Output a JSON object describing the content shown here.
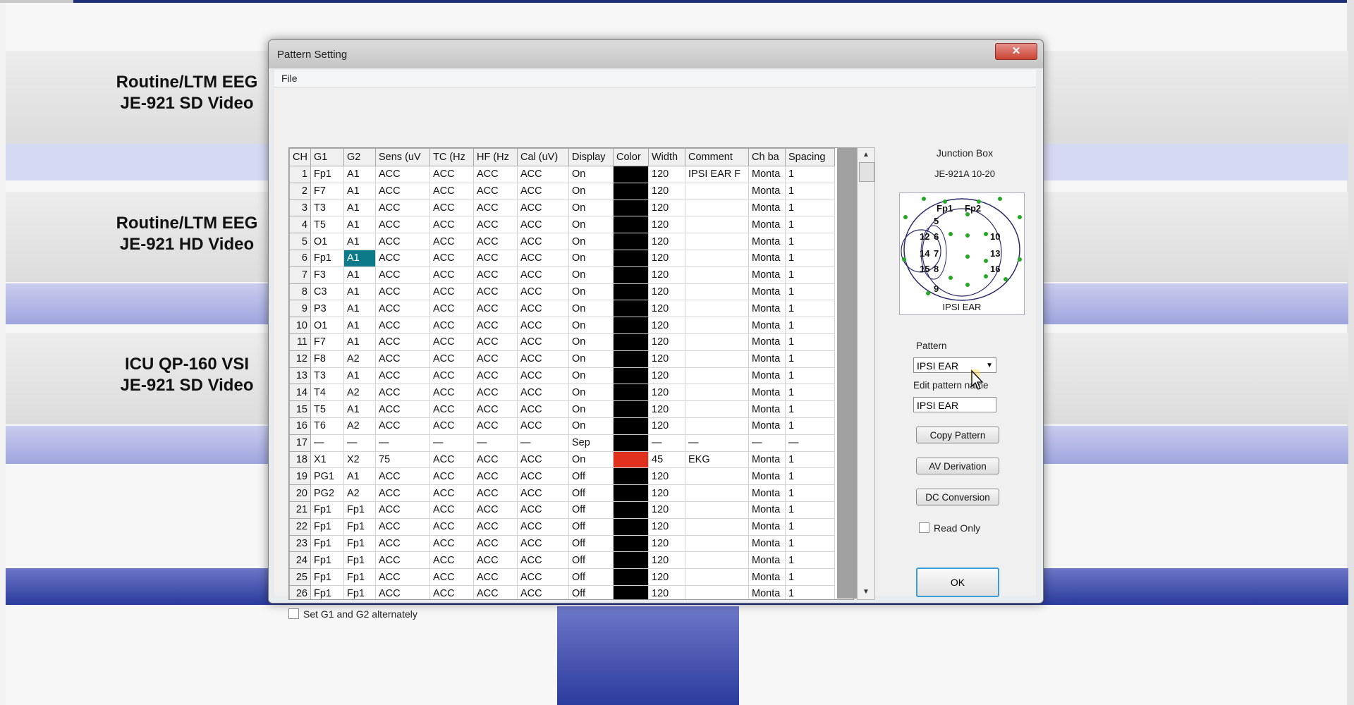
{
  "background": {
    "items": [
      {
        "line1": "Routine/LTM EEG",
        "line2": "JE-921 SD Video"
      },
      {
        "line1": "Routine/LTM EEG",
        "line2": "JE-921 HD Video"
      },
      {
        "line1": "ICU QP-160 VSI",
        "line2": "JE-921 SD Video"
      }
    ]
  },
  "dialog": {
    "title": "Pattern Setting",
    "close_label": "✕",
    "menu": {
      "file": "File"
    },
    "grid": {
      "columns": [
        "CH",
        "G1",
        "G2",
        "Sens (uV",
        "TC (Hz",
        "HF (Hz",
        "Cal (uV)",
        "Display",
        "Color",
        "Width",
        "Comment",
        "Ch ba",
        "Spacing"
      ],
      "rows": [
        {
          "ch": "1",
          "g1": "Fp1",
          "g2": "A1",
          "sens": "ACC",
          "tc": "ACC",
          "hf": "ACC",
          "cal": "ACC",
          "display": "On",
          "color": "#000000",
          "width": "120",
          "comment": "IPSI EAR F",
          "chba": "Monta",
          "spacing": "1"
        },
        {
          "ch": "2",
          "g1": "F7",
          "g2": "A1",
          "sens": "ACC",
          "tc": "ACC",
          "hf": "ACC",
          "cal": "ACC",
          "display": "On",
          "color": "#000000",
          "width": "120",
          "comment": "",
          "chba": "Monta",
          "spacing": "1"
        },
        {
          "ch": "3",
          "g1": "T3",
          "g2": "A1",
          "sens": "ACC",
          "tc": "ACC",
          "hf": "ACC",
          "cal": "ACC",
          "display": "On",
          "color": "#000000",
          "width": "120",
          "comment": "",
          "chba": "Monta",
          "spacing": "1"
        },
        {
          "ch": "4",
          "g1": "T5",
          "g2": "A1",
          "sens": "ACC",
          "tc": "ACC",
          "hf": "ACC",
          "cal": "ACC",
          "display": "On",
          "color": "#000000",
          "width": "120",
          "comment": "",
          "chba": "Monta",
          "spacing": "1"
        },
        {
          "ch": "5",
          "g1": "O1",
          "g2": "A1",
          "sens": "ACC",
          "tc": "ACC",
          "hf": "ACC",
          "cal": "ACC",
          "display": "On",
          "color": "#000000",
          "width": "120",
          "comment": "",
          "chba": "Monta",
          "spacing": "1"
        },
        {
          "ch": "6",
          "g1": "Fp1",
          "g2": "A1",
          "sens": "ACC",
          "tc": "ACC",
          "hf": "ACC",
          "cal": "ACC",
          "display": "On",
          "color": "#000000",
          "width": "120",
          "comment": "",
          "chba": "Monta",
          "spacing": "1",
          "selected": true
        },
        {
          "ch": "7",
          "g1": "F3",
          "g2": "A1",
          "sens": "ACC",
          "tc": "ACC",
          "hf": "ACC",
          "cal": "ACC",
          "display": "On",
          "color": "#000000",
          "width": "120",
          "comment": "",
          "chba": "Monta",
          "spacing": "1"
        },
        {
          "ch": "8",
          "g1": "C3",
          "g2": "A1",
          "sens": "ACC",
          "tc": "ACC",
          "hf": "ACC",
          "cal": "ACC",
          "display": "On",
          "color": "#000000",
          "width": "120",
          "comment": "",
          "chba": "Monta",
          "spacing": "1"
        },
        {
          "ch": "9",
          "g1": "P3",
          "g2": "A1",
          "sens": "ACC",
          "tc": "ACC",
          "hf": "ACC",
          "cal": "ACC",
          "display": "On",
          "color": "#000000",
          "width": "120",
          "comment": "",
          "chba": "Monta",
          "spacing": "1"
        },
        {
          "ch": "10",
          "g1": "O1",
          "g2": "A1",
          "sens": "ACC",
          "tc": "ACC",
          "hf": "ACC",
          "cal": "ACC",
          "display": "On",
          "color": "#000000",
          "width": "120",
          "comment": "",
          "chba": "Monta",
          "spacing": "1"
        },
        {
          "ch": "11",
          "g1": "F7",
          "g2": "A1",
          "sens": "ACC",
          "tc": "ACC",
          "hf": "ACC",
          "cal": "ACC",
          "display": "On",
          "color": "#000000",
          "width": "120",
          "comment": "",
          "chba": "Monta",
          "spacing": "1"
        },
        {
          "ch": "12",
          "g1": "F8",
          "g2": "A2",
          "sens": "ACC",
          "tc": "ACC",
          "hf": "ACC",
          "cal": "ACC",
          "display": "On",
          "color": "#000000",
          "width": "120",
          "comment": "",
          "chba": "Monta",
          "spacing": "1"
        },
        {
          "ch": "13",
          "g1": "T3",
          "g2": "A1",
          "sens": "ACC",
          "tc": "ACC",
          "hf": "ACC",
          "cal": "ACC",
          "display": "On",
          "color": "#000000",
          "width": "120",
          "comment": "",
          "chba": "Monta",
          "spacing": "1"
        },
        {
          "ch": "14",
          "g1": "T4",
          "g2": "A2",
          "sens": "ACC",
          "tc": "ACC",
          "hf": "ACC",
          "cal": "ACC",
          "display": "On",
          "color": "#000000",
          "width": "120",
          "comment": "",
          "chba": "Monta",
          "spacing": "1"
        },
        {
          "ch": "15",
          "g1": "T5",
          "g2": "A1",
          "sens": "ACC",
          "tc": "ACC",
          "hf": "ACC",
          "cal": "ACC",
          "display": "On",
          "color": "#000000",
          "width": "120",
          "comment": "",
          "chba": "Monta",
          "spacing": "1"
        },
        {
          "ch": "16",
          "g1": "T6",
          "g2": "A2",
          "sens": "ACC",
          "tc": "ACC",
          "hf": "ACC",
          "cal": "ACC",
          "display": "On",
          "color": "#000000",
          "width": "120",
          "comment": "",
          "chba": "Monta",
          "spacing": "1"
        },
        {
          "ch": "17",
          "g1": "—",
          "g2": "—",
          "sens": "—",
          "tc": "—",
          "hf": "—",
          "cal": "—",
          "display": "Sep",
          "color": "#000000",
          "width": "—",
          "comment": "—",
          "chba": "—",
          "spacing": "—"
        },
        {
          "ch": "18",
          "g1": "X1",
          "g2": "X2",
          "sens": "75",
          "tc": "ACC",
          "hf": "ACC",
          "cal": "ACC",
          "display": "On",
          "color": "#e0301e",
          "width": "45",
          "comment": "EKG",
          "chba": "Monta",
          "spacing": "1"
        },
        {
          "ch": "19",
          "g1": "PG1",
          "g2": "A1",
          "sens": "ACC",
          "tc": "ACC",
          "hf": "ACC",
          "cal": "ACC",
          "display": "Off",
          "color": "#000000",
          "width": "120",
          "comment": "",
          "chba": "Monta",
          "spacing": "1"
        },
        {
          "ch": "20",
          "g1": "PG2",
          "g2": "A2",
          "sens": "ACC",
          "tc": "ACC",
          "hf": "ACC",
          "cal": "ACC",
          "display": "Off",
          "color": "#000000",
          "width": "120",
          "comment": "",
          "chba": "Monta",
          "spacing": "1"
        },
        {
          "ch": "21",
          "g1": "Fp1",
          "g2": "Fp1",
          "sens": "ACC",
          "tc": "ACC",
          "hf": "ACC",
          "cal": "ACC",
          "display": "Off",
          "color": "#000000",
          "width": "120",
          "comment": "",
          "chba": "Monta",
          "spacing": "1"
        },
        {
          "ch": "22",
          "g1": "Fp1",
          "g2": "Fp1",
          "sens": "ACC",
          "tc": "ACC",
          "hf": "ACC",
          "cal": "ACC",
          "display": "Off",
          "color": "#000000",
          "width": "120",
          "comment": "",
          "chba": "Monta",
          "spacing": "1"
        },
        {
          "ch": "23",
          "g1": "Fp1",
          "g2": "Fp1",
          "sens": "ACC",
          "tc": "ACC",
          "hf": "ACC",
          "cal": "ACC",
          "display": "Off",
          "color": "#000000",
          "width": "120",
          "comment": "",
          "chba": "Monta",
          "spacing": "1"
        },
        {
          "ch": "24",
          "g1": "Fp1",
          "g2": "Fp1",
          "sens": "ACC",
          "tc": "ACC",
          "hf": "ACC",
          "cal": "ACC",
          "display": "Off",
          "color": "#000000",
          "width": "120",
          "comment": "",
          "chba": "Monta",
          "spacing": "1"
        },
        {
          "ch": "25",
          "g1": "Fp1",
          "g2": "Fp1",
          "sens": "ACC",
          "tc": "ACC",
          "hf": "ACC",
          "cal": "ACC",
          "display": "Off",
          "color": "#000000",
          "width": "120",
          "comment": "",
          "chba": "Monta",
          "spacing": "1"
        },
        {
          "ch": "26",
          "g1": "Fp1",
          "g2": "Fp1",
          "sens": "ACC",
          "tc": "ACC",
          "hf": "ACC",
          "cal": "ACC",
          "display": "Off",
          "color": "#000000",
          "width": "120",
          "comment": "",
          "chba": "Monta",
          "spacing": "1"
        }
      ]
    },
    "alternate_checkbox_label": "Set G1 and G2 alternately",
    "junction_box": {
      "title": "Junction Box",
      "model": "JE-921A 10-20",
      "map_labels": [
        "Fp1",
        "Fp2",
        "5",
        "6",
        "7",
        "8",
        "9",
        "10",
        "12",
        "13",
        "14",
        "15",
        "16"
      ],
      "map_caption": "IPSI EAR"
    },
    "pattern": {
      "label": "Pattern",
      "selected": "IPSI EAR",
      "edit_name_label": "Edit pattern name",
      "edit_name_value": "IPSI EAR"
    },
    "buttons": {
      "copy_pattern": "Copy Pattern",
      "av_derivation": "AV Derivation",
      "dc_conversion": "DC Conversion",
      "read_only": "Read Only",
      "ok": "OK"
    }
  }
}
